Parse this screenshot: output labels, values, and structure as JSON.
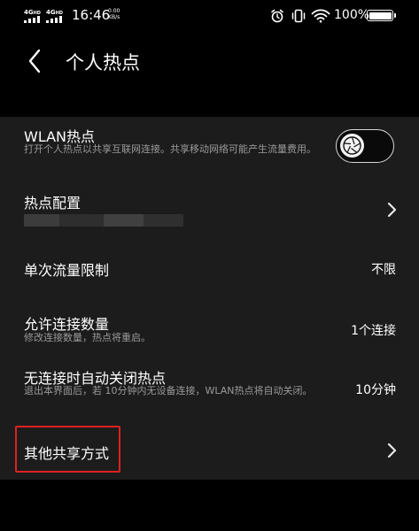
{
  "status_bar": {
    "sim1": {
      "network": "4G",
      "badge": "HD"
    },
    "sim2": {
      "network": "4G",
      "badge": "HD"
    },
    "time": "16:46",
    "speed_value": "0.00",
    "speed_unit": "KB/s",
    "battery_percent": "100%"
  },
  "header": {
    "title": "个人热点"
  },
  "rows": {
    "wlan": {
      "title": "WLAN热点",
      "subtitle": "打开个人热点以共享互联网连接。共享移动网络可能产生流量费用。",
      "toggle_on": false
    },
    "config": {
      "title": "热点配置"
    },
    "data_limit": {
      "title": "单次流量限制",
      "value": "不限"
    },
    "allowed": {
      "title": "允许连接数量",
      "subtitle": "修改连接数量，热点将重启。",
      "value": "1个连接"
    },
    "auto_off": {
      "title": "无连接时自动关闭热点",
      "subtitle": "退出本界面后，若 10分钟内无设备连接，WLAN热点将自动关闭。",
      "value": "10分钟"
    },
    "other": {
      "title": "其他共享方式"
    }
  }
}
